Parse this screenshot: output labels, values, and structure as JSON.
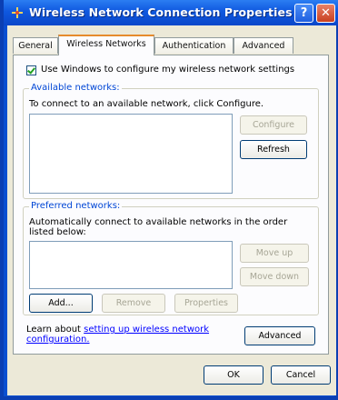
{
  "window": {
    "title": "Wireless Network Connection Properties"
  },
  "titlebar": {
    "help_symbol": "?",
    "close_symbol": "✕"
  },
  "tabs": [
    {
      "label": "General",
      "active": false
    },
    {
      "label": "Wireless Networks",
      "active": true
    },
    {
      "label": "Authentication",
      "active": false
    },
    {
      "label": "Advanced",
      "active": false
    }
  ],
  "checkbox": {
    "label": "Use Windows to configure my wireless network settings",
    "checked": true
  },
  "available": {
    "title": "Available networks:",
    "description": "To connect to an available network, click Configure.",
    "configure_label": "Configure",
    "refresh_label": "Refresh"
  },
  "preferred": {
    "title": "Preferred networks:",
    "description": "Automatically connect to available networks in the order listed below:",
    "move_up_label": "Move up",
    "move_down_label": "Move down",
    "add_label": "Add...",
    "remove_label": "Remove",
    "properties_label": "Properties"
  },
  "footer": {
    "learn_prefix": "Learn about ",
    "learn_link": "setting up wireless network configuration.",
    "advanced_label": "Advanced"
  },
  "dialog": {
    "ok_label": "OK",
    "cancel_label": "Cancel"
  },
  "colors": {
    "titlebar": "#0a4fd1",
    "group_title": "#0046d5",
    "active_tab_top": "#e68b2c"
  }
}
